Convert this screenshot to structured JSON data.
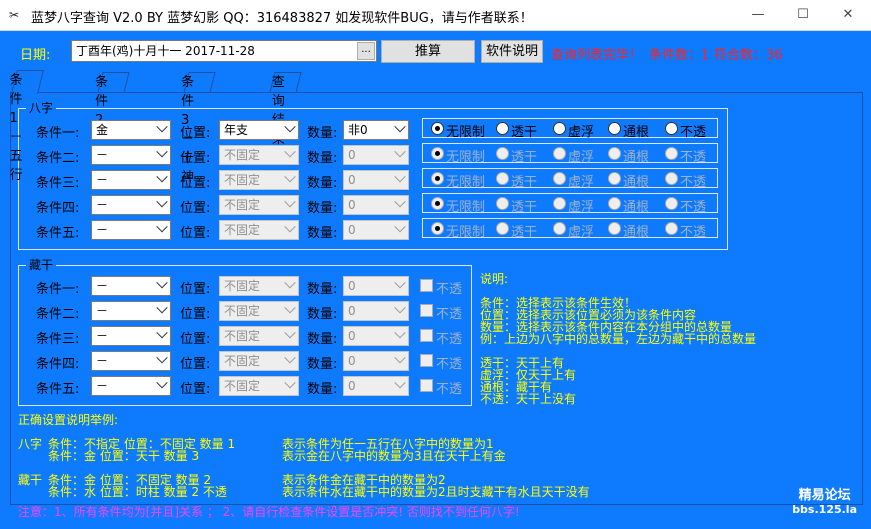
{
  "titlebar": {
    "title": "蓝梦八字查询 V2.0 BY 蓝梦幻影 QQ：316483827 如发现软件BUG，请与作者联系！",
    "min": "—",
    "max": "☐",
    "close": "✕"
  },
  "top": {
    "date_label": "日期:",
    "date_value": "丁酉年(鸡)十月十一  2017-11-28",
    "date_btn": "...",
    "calc_btn": "推算",
    "help_btn": "软件说明",
    "status": "查询列表完毕！",
    "cond_count": "条件数：1",
    "match_count": "符合数：36"
  },
  "tabs": [
    "条件1－五行",
    "条件2－干支",
    "条件3－十神",
    "查询结果"
  ],
  "bazi": {
    "legend": "八字",
    "rows": [
      {
        "label": "条件一:",
        "wuxing": "金",
        "pos_label": "位置:",
        "pos": "年支",
        "num_label": "数量:",
        "num": "非0",
        "enabled": true
      },
      {
        "label": "条件二:",
        "wuxing": "－",
        "pos_label": "位置:",
        "pos": "不固定",
        "num_label": "数量:",
        "num": "0",
        "enabled": false
      },
      {
        "label": "条件三:",
        "wuxing": "－",
        "pos_label": "位置:",
        "pos": "不固定",
        "num_label": "数量:",
        "num": "0",
        "enabled": false
      },
      {
        "label": "条件四:",
        "wuxing": "－",
        "pos_label": "位置:",
        "pos": "不固定",
        "num_label": "数量:",
        "num": "0",
        "enabled": false
      },
      {
        "label": "条件五:",
        "wuxing": "－",
        "pos_label": "位置:",
        "pos": "不固定",
        "num_label": "数量:",
        "num": "0",
        "enabled": false
      }
    ],
    "radios": [
      "无限制",
      "透干",
      "虚浮",
      "通根",
      "不透"
    ]
  },
  "canggan": {
    "legend": "藏干",
    "rows": [
      {
        "label": "条件一:",
        "wuxing": "－",
        "pos_label": "位置:",
        "pos": "不固定",
        "num_label": "数量:",
        "num": "0",
        "chk": "不透"
      },
      {
        "label": "条件二:",
        "wuxing": "－",
        "pos_label": "位置:",
        "pos": "不固定",
        "num_label": "数量:",
        "num": "0",
        "chk": "不透"
      },
      {
        "label": "条件三:",
        "wuxing": "－",
        "pos_label": "位置:",
        "pos": "不固定",
        "num_label": "数量:",
        "num": "0",
        "chk": "不透"
      },
      {
        "label": "条件四:",
        "wuxing": "－",
        "pos_label": "位置:",
        "pos": "不固定",
        "num_label": "数量:",
        "num": "0",
        "chk": "不透"
      },
      {
        "label": "条件五:",
        "wuxing": "－",
        "pos_label": "位置:",
        "pos": "不固定",
        "num_label": "数量:",
        "num": "0",
        "chk": "不透"
      }
    ]
  },
  "explain": {
    "title": "说明:",
    "lines1": [
      "条件：选择表示该条件生效！",
      "位置：选择表示该位置必须为该条件内容",
      "数量：选择表示该条件内容在本分组中的总数量",
      "例：上边为八字中的总数量，左边为藏干中的总数量"
    ],
    "lines2": [
      "透干：天干上有",
      "虚浮：仅天干上有",
      "通根：藏干有",
      "不透：天干上没有"
    ]
  },
  "examples": {
    "title": "正确设置说明举例:",
    "bazi_tag": "八字",
    "bazi_l1": "条件：不指定   位置：不固定  数量 1",
    "bazi_d1": "表示条件为任一五行在八字中的数量为1",
    "bazi_l2": "条件：金         位置：天干    数量 3",
    "bazi_d2": "表示金在八字中的数量为3且在天干上有金",
    "cang_tag": "藏干",
    "cang_l1": "条件：金         位置：不固定  数量 2",
    "cang_d1": "表示条件金在藏干中的数量为2",
    "cang_l2": "条件：水         位置：时柱    数量 2  不透",
    "cang_d2": "表示条件水在藏干中的数量为2且时支藏干有水且天干没有"
  },
  "footer": {
    "note": "注意：1、所有条件均为[并且]关系 ；   2、请自行检查条件设置是否冲突! 否则找不到任何八字!",
    "logo1": "精易论坛",
    "logo2": "bbs.125.la"
  }
}
